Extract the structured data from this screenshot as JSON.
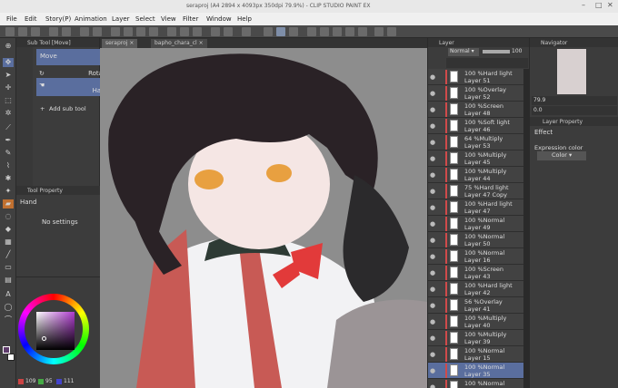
{
  "titlebar": {
    "title": "seraproj (A4 2894 x 4093px 350dpi 79.9%) - CLIP STUDIO PAINT EX"
  },
  "menu": {
    "items": [
      "File",
      "Edit",
      "Story(P)",
      "Animation",
      "Layer",
      "Select",
      "View",
      "Filter",
      "Window",
      "Help"
    ]
  },
  "subtool": {
    "title": "Sub Tool [Move]",
    "items": [
      "Move",
      "Rotate",
      "Hand"
    ],
    "add": "Add sub tool"
  },
  "toolprop": {
    "title": "Tool Property",
    "name": "Hand",
    "empty": "No settings"
  },
  "color": {
    "r": "109",
    "g": "95",
    "b": "111",
    "bg": "#5e3b6b"
  },
  "tabs": [
    "seraproj",
    "bapho_chara_cl"
  ],
  "layerpanel": {
    "title": "Layer",
    "blend": "Normal",
    "opacity": "100",
    "layers": [
      {
        "mode": "100 %Hard light",
        "name": "Layer 51"
      },
      {
        "mode": "100 %Overlay",
        "name": "Layer 52"
      },
      {
        "mode": "100 %Screen",
        "name": "Layer 48"
      },
      {
        "mode": "100 %Soft light",
        "name": "Layer 46"
      },
      {
        "mode": "64 %Multiply",
        "name": "Layer 53"
      },
      {
        "mode": "100 %Multiply",
        "name": "Layer 45"
      },
      {
        "mode": "100 %Multiply",
        "name": "Layer 44"
      },
      {
        "mode": "75 %Hard light",
        "name": "Layer 47 Copy"
      },
      {
        "mode": "100 %Hard light",
        "name": "Layer 47"
      },
      {
        "mode": "100 %Normal",
        "name": "Layer 49"
      },
      {
        "mode": "100 %Normal",
        "name": "Layer 50"
      },
      {
        "mode": "100 %Normal",
        "name": "Layer 16"
      },
      {
        "mode": "100 %Screen",
        "name": "Layer 43"
      },
      {
        "mode": "100 %Hard light",
        "name": "Layer 42"
      },
      {
        "mode": "56 %Overlay",
        "name": "Layer 41"
      },
      {
        "mode": "100 %Multiply",
        "name": "Layer 40"
      },
      {
        "mode": "100 %Multiply",
        "name": "Layer 39"
      },
      {
        "mode": "100 %Normal",
        "name": "Layer 15"
      },
      {
        "mode": "100 %Normal",
        "name": "Layer 35"
      },
      {
        "mode": "100 %Normal",
        "name": ""
      }
    ]
  },
  "navigator": {
    "title": "Navigator",
    "zoom": "79.9",
    "angle": "0.0"
  },
  "layerprop": {
    "title": "Layer Property",
    "effect": "Effect",
    "expr": "Expression color",
    "exprval": "Color"
  }
}
